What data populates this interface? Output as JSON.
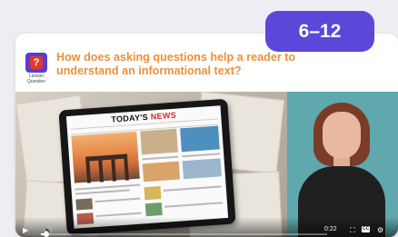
{
  "grade_badge": "6–12",
  "lesson": {
    "icon_glyph": "?",
    "icon_label_line1": "Lesson",
    "icon_label_line2": "Question",
    "accent_color": "#5b3dc8"
  },
  "question_text": "How does asking questions help a reader to understand an informational text?",
  "colors": {
    "badge": "#5b48d9",
    "question": "#eb8f3a",
    "news_red": "#d62b2b"
  },
  "video": {
    "newspaper": {
      "masthead_part1": "TODAY'S ",
      "masthead_part2": "NEWS"
    },
    "progress_fraction": 0.02,
    "time": "0:22",
    "cc_label": "CC"
  }
}
